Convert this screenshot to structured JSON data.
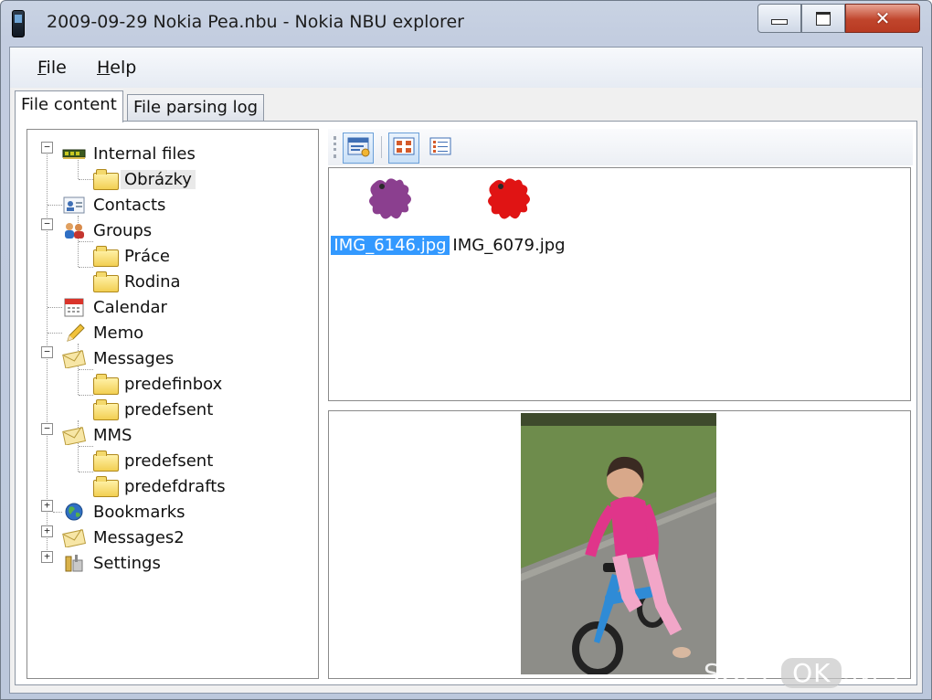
{
  "window": {
    "title": "2009-09-29 Nokia Pea.nbu - Nokia NBU explorer",
    "controls": {
      "minimize": "",
      "maximize": "",
      "close": "✕"
    }
  },
  "menu": [
    {
      "key": "F",
      "rest": "ile"
    },
    {
      "key": "H",
      "rest": "elp"
    }
  ],
  "tabs": {
    "file_content": "File content",
    "file_parsing_log": "File parsing log"
  },
  "tree": {
    "internal_files": "Internal files",
    "obrazky": "Obrázky",
    "contacts": "Contacts",
    "groups": "Groups",
    "prace": "Práce",
    "rodina": "Rodina",
    "calendar": "Calendar",
    "memo": "Memo",
    "messages": "Messages",
    "predefinbox": "predefinbox",
    "predefsent": "predefsent",
    "mms": "MMS",
    "mms_predefsent": "predefsent",
    "predefdrafts": "predefdrafts",
    "bookmarks": "Bookmarks",
    "messages2": "Messages2",
    "settings": "Settings",
    "expander_minus": "−",
    "expander_plus": "+"
  },
  "files": [
    {
      "name": "IMG_6146.jpg",
      "selected": true,
      "icon_color": "#8b3f8f"
    },
    {
      "name": "IMG_6079.jpg",
      "selected": false,
      "icon_color": "#e01414"
    }
  ],
  "colors": {
    "selection": "#3399ff",
    "close_button": "#c0452c"
  },
  "watermark": {
    "left": "SOFT-",
    "mid": "OK",
    "right": ".NET"
  }
}
